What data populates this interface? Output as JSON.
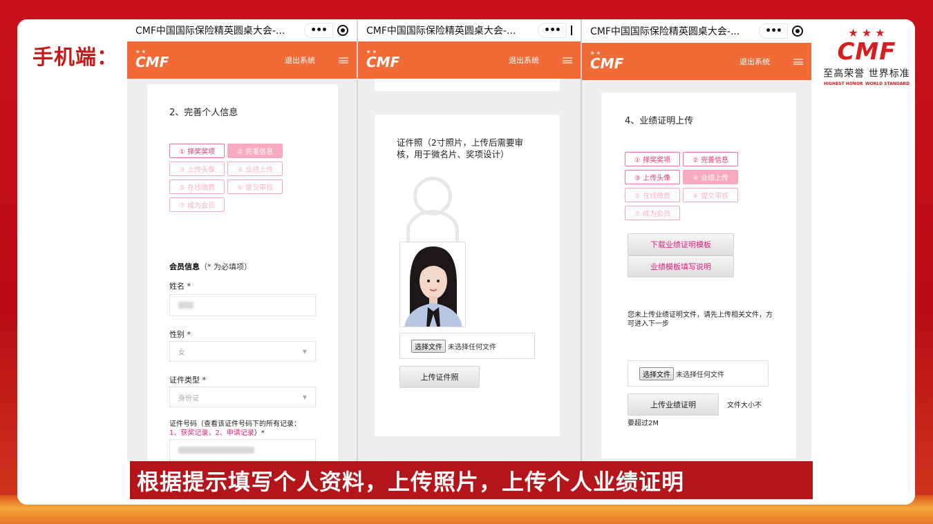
{
  "slide": {
    "label": "手机端：",
    "caption": "根据提示填写个人资料，上传照片，上传个人业绩证明"
  },
  "brand": {
    "mark": "CMF",
    "stars": "★ ★ ★",
    "tagline": "至高荣誉 世界标准",
    "sub_left": "HIGHEST HONOR",
    "sub_right": "WORLD STANDARD"
  },
  "wx": {
    "title": "CMF中国国际保险精英圆桌大会-...",
    "more": "•••"
  },
  "app": {
    "logo": "CMF",
    "logout": "退出系统"
  },
  "steps": [
    "① 择奖奖项",
    "② 完善信息",
    "③ 上传头像",
    "④ 业绩上传",
    "⑤ 在线缴费",
    "⑥ 提交审核",
    "⑦ 成为会员"
  ],
  "phone1": {
    "section_title": "2、完善个人信息",
    "member_info_label": "会员信息",
    "member_info_note": "（* 为必填项）",
    "name_label": "姓名 *",
    "gender_label": "性别 *",
    "gender_value": "女",
    "id_type_label": "证件类型 *",
    "id_type_value": "身份证",
    "id_no_label": "证件号码（查看该证件号码下的所有记录：",
    "id_no_links": "1、获奖记录，2、申请记录",
    "id_no_tail": "）*"
  },
  "phone2": {
    "photo_note": "证件照（2寸照片，上传后需要审核，用于微名片、奖项设计）",
    "choose_file": "选择文件",
    "no_file": "未选择任何文件",
    "upload_button": "上传证件照"
  },
  "phone3": {
    "section_title": "4、业绩证明上传",
    "download_template": "下载业绩证明模板",
    "template_help": "业绩模板填写说明",
    "notice": "您未上传业绩证明文件，请先上传相关文件，方可进入下一步",
    "choose_file": "选择文件",
    "no_file": "未选择任何文件",
    "upload_button": "上传业绩证明",
    "size_note_1": "文件大小不",
    "size_note_2": "要超过2M"
  },
  "colors": {
    "header_orange": "#f26a35",
    "step_pink": "#f6a9bf",
    "link_pink": "#e0237e",
    "caption_red": "#b3151b"
  }
}
